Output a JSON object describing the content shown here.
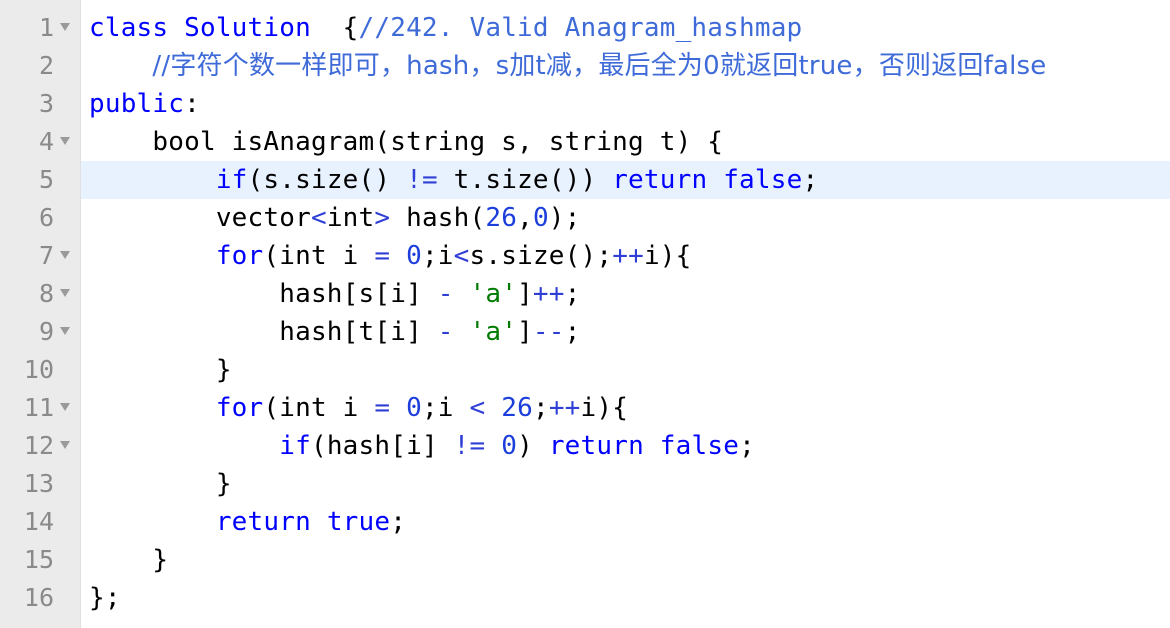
{
  "editor": {
    "lines": [
      {
        "n": "1",
        "fold": true,
        "tokens": [
          [
            "kw",
            "class Solution"
          ],
          [
            "",
            "  {"
          ],
          [
            "cm",
            "//242. Valid Anagram_hashmap"
          ]
        ]
      },
      {
        "n": "2",
        "fold": false,
        "tokens": [
          [
            "",
            "    "
          ],
          [
            "cm",
            "//字符个数一样即可，hash，s加t减，最后全为0就返回true，否则返回false"
          ]
        ]
      },
      {
        "n": "3",
        "fold": false,
        "tokens": [
          [
            "kw",
            "public"
          ],
          [
            "",
            ":"
          ]
        ]
      },
      {
        "n": "4",
        "fold": true,
        "tokens": [
          [
            "",
            "    bool isAnagram(string s, string t) {"
          ]
        ]
      },
      {
        "n": "5",
        "fold": false,
        "active": true,
        "tokens": [
          [
            "",
            "        "
          ],
          [
            "kw",
            "if"
          ],
          [
            "",
            "(s.size() "
          ],
          [
            "op",
            "!="
          ],
          [
            "",
            " t.size()) "
          ],
          [
            "kw",
            "return"
          ],
          [
            "",
            " "
          ],
          [
            "kw",
            "false"
          ],
          [
            "",
            ";"
          ]
        ]
      },
      {
        "n": "6",
        "fold": false,
        "tokens": [
          [
            "",
            "        vector"
          ],
          [
            "op",
            "<"
          ],
          [
            "",
            "int"
          ],
          [
            "op",
            ">"
          ],
          [
            "",
            " hash("
          ],
          [
            "num",
            "26"
          ],
          [
            "",
            ","
          ],
          [
            "num",
            "0"
          ],
          [
            "",
            ");"
          ]
        ]
      },
      {
        "n": "7",
        "fold": true,
        "tokens": [
          [
            "",
            "        "
          ],
          [
            "kw",
            "for"
          ],
          [
            "",
            "(int i "
          ],
          [
            "op",
            "="
          ],
          [
            "",
            " "
          ],
          [
            "num",
            "0"
          ],
          [
            "",
            ";i"
          ],
          [
            "op",
            "<"
          ],
          [
            "",
            "s.size();"
          ],
          [
            "op",
            "++"
          ],
          [
            "",
            "i){"
          ]
        ]
      },
      {
        "n": "8",
        "fold": true,
        "tokens": [
          [
            "",
            "            hash[s[i] "
          ],
          [
            "op",
            "-"
          ],
          [
            "",
            " "
          ],
          [
            "str",
            "'a'"
          ],
          [
            "",
            "]"
          ],
          [
            "op",
            "++"
          ],
          [
            "",
            ";"
          ]
        ]
      },
      {
        "n": "9",
        "fold": true,
        "tokens": [
          [
            "",
            "            hash[t[i] "
          ],
          [
            "op",
            "-"
          ],
          [
            "",
            " "
          ],
          [
            "str",
            "'a'"
          ],
          [
            "",
            "]"
          ],
          [
            "op",
            "--"
          ],
          [
            "",
            ";"
          ]
        ]
      },
      {
        "n": "10",
        "fold": false,
        "tokens": [
          [
            "",
            "        }"
          ]
        ]
      },
      {
        "n": "11",
        "fold": true,
        "tokens": [
          [
            "",
            "        "
          ],
          [
            "kw",
            "for"
          ],
          [
            "",
            "(int i "
          ],
          [
            "op",
            "="
          ],
          [
            "",
            " "
          ],
          [
            "num",
            "0"
          ],
          [
            "",
            ";i "
          ],
          [
            "op",
            "<"
          ],
          [
            "",
            " "
          ],
          [
            "num",
            "26"
          ],
          [
            "",
            ";"
          ],
          [
            "op",
            "++"
          ],
          [
            "",
            "i){"
          ]
        ]
      },
      {
        "n": "12",
        "fold": true,
        "tokens": [
          [
            "",
            "            "
          ],
          [
            "kw",
            "if"
          ],
          [
            "",
            "(hash[i] "
          ],
          [
            "op",
            "!="
          ],
          [
            "",
            " "
          ],
          [
            "num",
            "0"
          ],
          [
            "",
            ") "
          ],
          [
            "kw",
            "return"
          ],
          [
            "",
            " "
          ],
          [
            "kw",
            "false"
          ],
          [
            "",
            ";"
          ]
        ]
      },
      {
        "n": "13",
        "fold": false,
        "tokens": [
          [
            "",
            "        }"
          ]
        ]
      },
      {
        "n": "14",
        "fold": false,
        "tokens": [
          [
            "",
            "        "
          ],
          [
            "kw",
            "return"
          ],
          [
            "",
            " "
          ],
          [
            "kw",
            "true"
          ],
          [
            "",
            ";"
          ]
        ]
      },
      {
        "n": "15",
        "fold": false,
        "tokens": [
          [
            "",
            "    }"
          ]
        ]
      },
      {
        "n": "16",
        "fold": false,
        "tokens": [
          [
            "",
            "};"
          ]
        ]
      }
    ],
    "colors": {
      "keyword": "#0000ff",
      "comment": "#3f6bd8",
      "number": "#1c3edb",
      "string": "#007a00",
      "gutter": "#ebebeb",
      "active_line": "#e8f2fe"
    }
  }
}
